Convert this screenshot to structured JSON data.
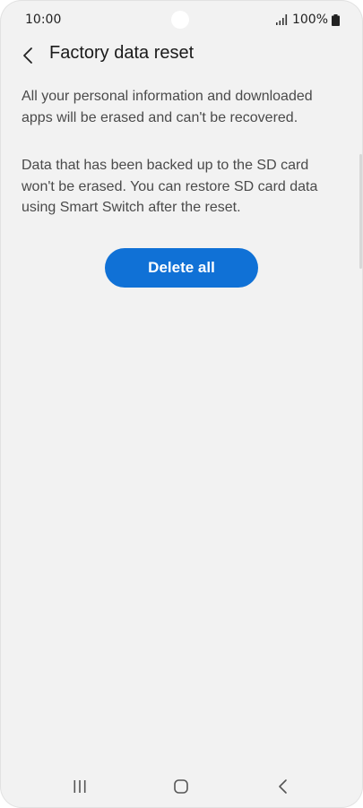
{
  "status_bar": {
    "time": "10:00",
    "battery_percent": "100%",
    "icons": [
      "signal-icon",
      "battery-icon"
    ]
  },
  "header": {
    "back_icon": "chevron-left-icon",
    "title": "Factory data reset"
  },
  "content": {
    "paragraphs": [
      "All your personal information and downloaded apps will be erased and can't be recovered.",
      "Data that has been backed up to the SD card won't be erased. You can restore SD card data using Smart Switch after the reset."
    ],
    "button_label": "Delete all"
  },
  "nav_bar": {
    "icons": [
      "recents-icon",
      "home-icon",
      "back-icon"
    ]
  },
  "colors": {
    "background": "#f2f2f2",
    "accent": "#1071d6",
    "text_primary": "#1a1a1a",
    "text_secondary": "#4a4a4a"
  }
}
